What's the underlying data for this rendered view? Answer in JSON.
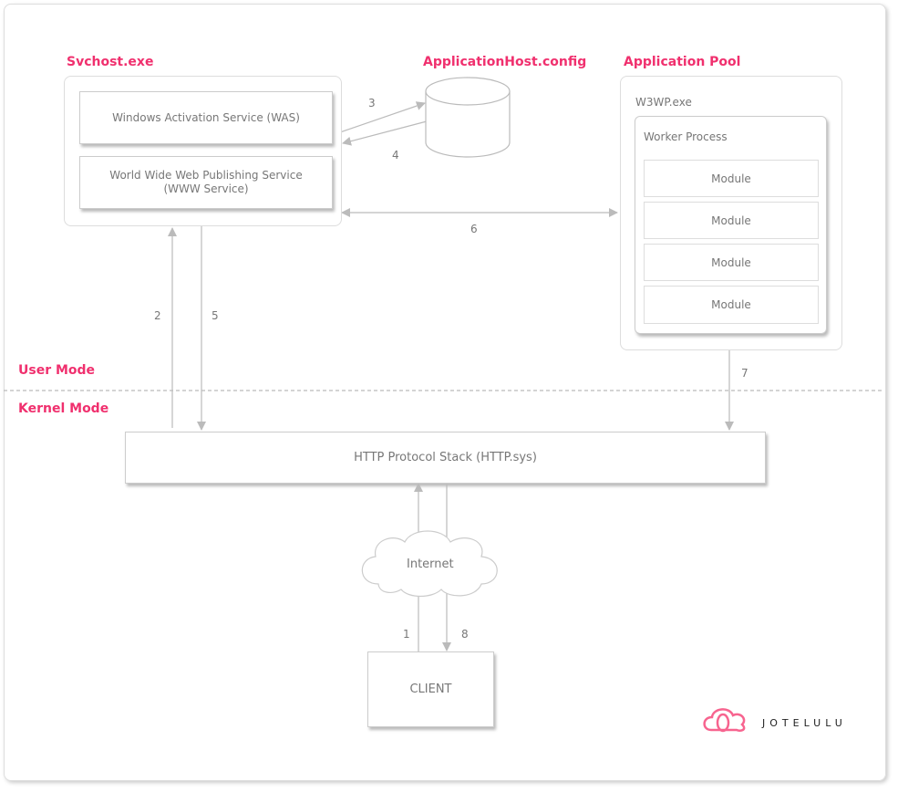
{
  "svchost": {
    "title": "Svchost.exe",
    "was": "Windows Activation Service (WAS)",
    "www_line1": "World Wide Web Publishing Service",
    "www_line2": "(WWW Service)"
  },
  "config": {
    "title": "ApplicationHost.config"
  },
  "pool": {
    "title": "Application Pool",
    "w3wp": "W3WP.exe",
    "worker": "Worker Process",
    "modules": [
      "Module",
      "Module",
      "Module",
      "Module"
    ]
  },
  "modes": {
    "user": "User Mode",
    "kernel": "Kernel Mode"
  },
  "http": "HTTP Protocol Stack (HTTP.sys)",
  "internet": "Internet",
  "client": "CLIENT",
  "steps": [
    "1",
    "2",
    "3",
    "4",
    "5",
    "6",
    "7",
    "8"
  ],
  "logo": "JOTELULU",
  "colors": {
    "accent": "#f0306e",
    "line": "#bbbbbb",
    "text": "#777777"
  }
}
